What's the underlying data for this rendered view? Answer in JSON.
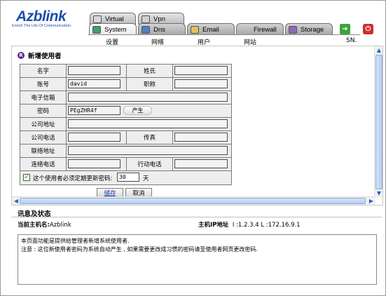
{
  "brand": {
    "name": "Azblink",
    "tagline": "Enrich The Life Of Communication"
  },
  "tabs_back": [
    {
      "label": "Virtual",
      "icon": "virtual-icon"
    },
    {
      "label": "Vpn",
      "icon": "vpn-icon"
    }
  ],
  "tabs_front": [
    {
      "label": "System",
      "icon": "system-icon",
      "active": true
    },
    {
      "label": "Dns",
      "icon": "dns-icon"
    },
    {
      "label": "Email",
      "icon": "email-icon"
    },
    {
      "label": "Firewall",
      "icon": "firewall-icon"
    },
    {
      "label": "Storage",
      "icon": "storage-icon"
    }
  ],
  "submenu": [
    "设置",
    "网络",
    "用户",
    "网站",
    "SN."
  ],
  "utility": {
    "forward_icon": "forward-arrow-icon",
    "power_icon": "power-icon"
  },
  "section_title": "新增使用者",
  "form": {
    "name_label": "名字",
    "surname_label": "姓氏",
    "account_label": "账号",
    "account_value": "david",
    "title_label": "职称",
    "email_label": "电子信箱",
    "password_label": "密码",
    "password_value": "PEgZHR4f",
    "generate_label": "产生",
    "company_address_label": "公司地址",
    "company_phone_label": "公司电话",
    "fax_label": "传真",
    "contact_address_label": "联络地址",
    "contact_phone_label": "连络电话",
    "mobile_label": "行动电话",
    "expire_label": "这个使用者必须定期更新密码:",
    "expire_days": "30",
    "expire_unit": "天"
  },
  "actions": {
    "save": "储存",
    "cancel": "取消"
  },
  "status": {
    "title": "讯息及状态",
    "host_label": "当前主机名:",
    "host_value": "Azblink",
    "ip_label": "主机IP地址",
    "ip_text": "I :1.2.3.4   L :172.16.9.1",
    "message_line1": "本页面功能是提供给管理者新增系统使用者.",
    "message_line2": "注意 : 这位新使用者密码为系统自动产生 , 如果需要更改成习惯的密码请至使用者网页更改密码."
  },
  "colors": {
    "brand_blue": "#1b4fa8",
    "scroll_blue": "#b6cdf0",
    "check_green": "#2c8a1f"
  }
}
